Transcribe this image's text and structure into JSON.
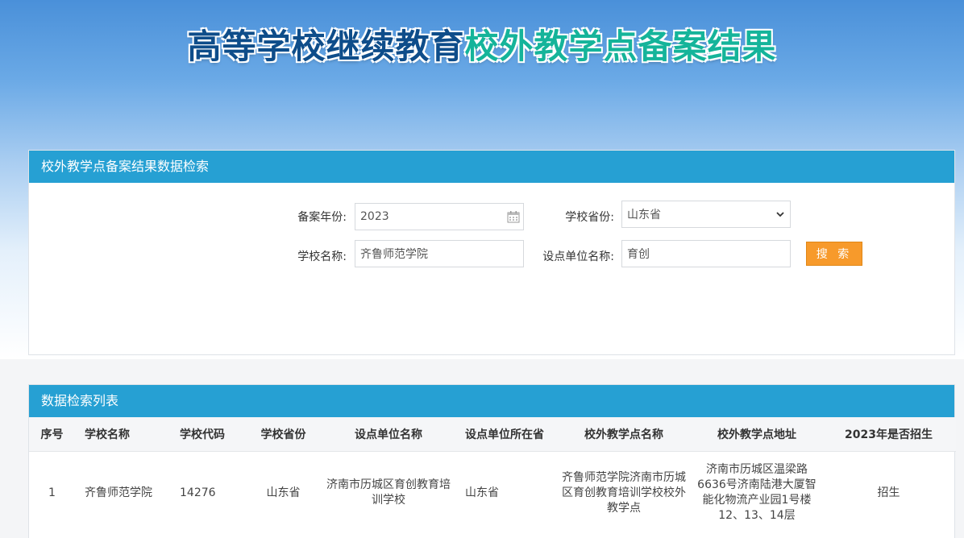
{
  "page": {
    "title_part1": "高等学校继续教育",
    "title_part2": "校外教学点备案结果"
  },
  "search": {
    "header": "校外教学点备案结果数据检索",
    "year_label": "备案年份:",
    "year_value": "2023",
    "province_label": "学校省份:",
    "province_value": "山东省",
    "school_label": "学校名称:",
    "school_value": "齐鲁师范学院",
    "unit_label": "设点单位名称:",
    "unit_value": "育创",
    "search_button": "搜 索"
  },
  "list": {
    "header": "数据检索列表",
    "columns": [
      "序号",
      "学校名称",
      "学校代码",
      "学校省份",
      "设点单位名称",
      "设点单位所在省",
      "校外教学点名称",
      "校外教学点地址",
      "2023年是否招生"
    ],
    "rows": [
      [
        "1",
        "齐鲁师范学院",
        "14276",
        "山东省",
        "济南市历城区育创教育培训学校",
        "山东省",
        "齐鲁师范学院济南市历城区育创教育培训学校校外教学点",
        "济南市历城区温梁路6636号济南陆港大厦智能化物流产业园1号楼12、13、14层",
        "招生"
      ]
    ]
  },
  "colors": {
    "panel_header": "#26a0d3",
    "search_button": "#f79a2b",
    "title_dark": "#0e4d8a",
    "title_teal": "#15b49a"
  }
}
